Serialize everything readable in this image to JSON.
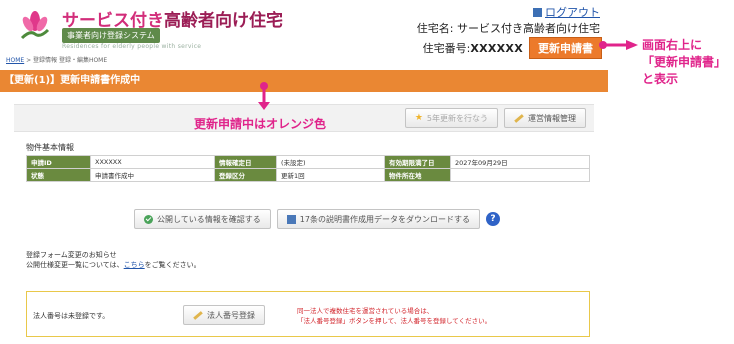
{
  "header": {
    "title_part1": "サービス付き",
    "title_part2": "高齢者向け住宅",
    "system_badge": "事業者向け登録システム",
    "subtitle": "Residences for elderly people with service",
    "logout_label": "ログアウト",
    "house_name_label": "住宅名:",
    "house_name_value": "サービス付き高齢者向け住宅",
    "house_no_label": "住宅番号:",
    "house_no_value": "XXXXXX",
    "renewal_badge": "更新申請書"
  },
  "breadcrumb": {
    "home": "HOME",
    "rest": " > 登録情報 登録・編集HOME"
  },
  "status_bar": "【更新(1)】更新申請書作成中",
  "toolbar": {
    "renew5_label": "5年更新を行なう",
    "manage_label": "運営情報管理"
  },
  "section_title": "物件基本情報",
  "info_table": {
    "rows": [
      [
        "申請ID",
        "XXXXXX",
        "情報確定日",
        "(未設定)",
        "有効期限満了日",
        "2027年09月29日"
      ],
      [
        "状態",
        "申請書作成中",
        "登録区分",
        "更新1回",
        "物件所在地",
        ""
      ]
    ]
  },
  "mid_buttons": {
    "check_public": "公開している情報を確認する",
    "download": "17条の説明書作成用データをダウンロードする",
    "help": "?"
  },
  "notice": {
    "title": "登録フォーム変更のお知らせ",
    "body_pre": "公開仕様変更一覧については、",
    "link": "こちら",
    "body_post": "をご覧ください。"
  },
  "corp": {
    "status_text": "法人番号は未登録です。",
    "button_label": "法人番号登録",
    "warning_line1": "同一法人で複数住宅を運営されている場合は、",
    "warning_line2": "「法人番号登録」ボタンを押して、法人番号を登録してください。"
  },
  "annotations": {
    "middle": "更新申請中はオレンジ色",
    "right_line1": "画面右上に",
    "right_line2": "「更新申請書」",
    "right_line3": "と表示"
  },
  "colors": {
    "status_bar": "#ea8733",
    "table_header": "#6a8a3f",
    "annotation": "#e0248b",
    "warning": "#d2232a"
  }
}
